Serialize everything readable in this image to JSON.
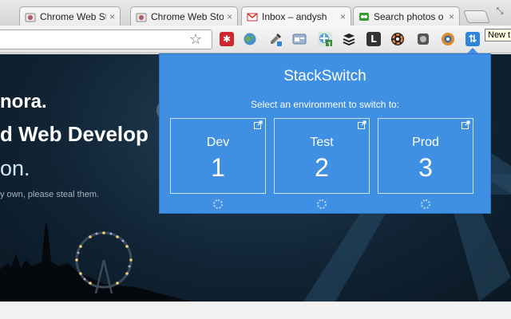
{
  "tabs": [
    {
      "title": "Chrome Web Sto",
      "close": "×",
      "favicon": "chrome-webstore-icon"
    },
    {
      "title": "Chrome Web Sto",
      "close": "×",
      "favicon": "chrome-webstore-icon"
    },
    {
      "title": "Inbox – andysh",
      "close": "×",
      "favicon": "gmail-icon"
    },
    {
      "title": "Search photos o",
      "close": "×",
      "favicon": "flickr-icon"
    }
  ],
  "window": {
    "control": "⤡"
  },
  "toolbar": {
    "star": "☆"
  },
  "tooltip": "New t",
  "extensions": [
    {
      "icon": "lastpass-icon",
      "glyph": "✱",
      "color": "#d0262d"
    },
    {
      "icon": "globe-icon",
      "glyph": "",
      "color": "#4a90c8"
    },
    {
      "icon": "eyedropper-icon",
      "glyph": "",
      "color": "#666666"
    },
    {
      "icon": "window-icon",
      "glyph": "",
      "color": "#8fa8c8"
    },
    {
      "icon": "tab-badge-icon",
      "glyph": "1",
      "color": "#4a9a5c"
    },
    {
      "icon": "buffer-icon",
      "glyph": "≡",
      "color": "#222222"
    },
    {
      "icon": "l-icon",
      "glyph": "L",
      "color": "#333333"
    },
    {
      "icon": "colorwheel-icon",
      "glyph": "",
      "color": "#444444"
    },
    {
      "icon": "evernote-icon",
      "glyph": "",
      "color": "#555555"
    },
    {
      "icon": "camera-icon",
      "glyph": "",
      "color": "#e0892b"
    },
    {
      "icon": "stackswitch-icon",
      "glyph": "⇅",
      "color": "#2f84dc"
    }
  ],
  "page": {
    "line1": "nora.",
    "line2": "d Web Develop",
    "line3": "on.",
    "line4": "y own, please steal them."
  },
  "popup": {
    "title": "StackSwitch",
    "subtitle": "Select an environment to switch to:",
    "environments": [
      {
        "name": "Dev",
        "number": "1"
      },
      {
        "name": "Test",
        "number": "2"
      },
      {
        "name": "Prod",
        "number": "3"
      }
    ]
  }
}
